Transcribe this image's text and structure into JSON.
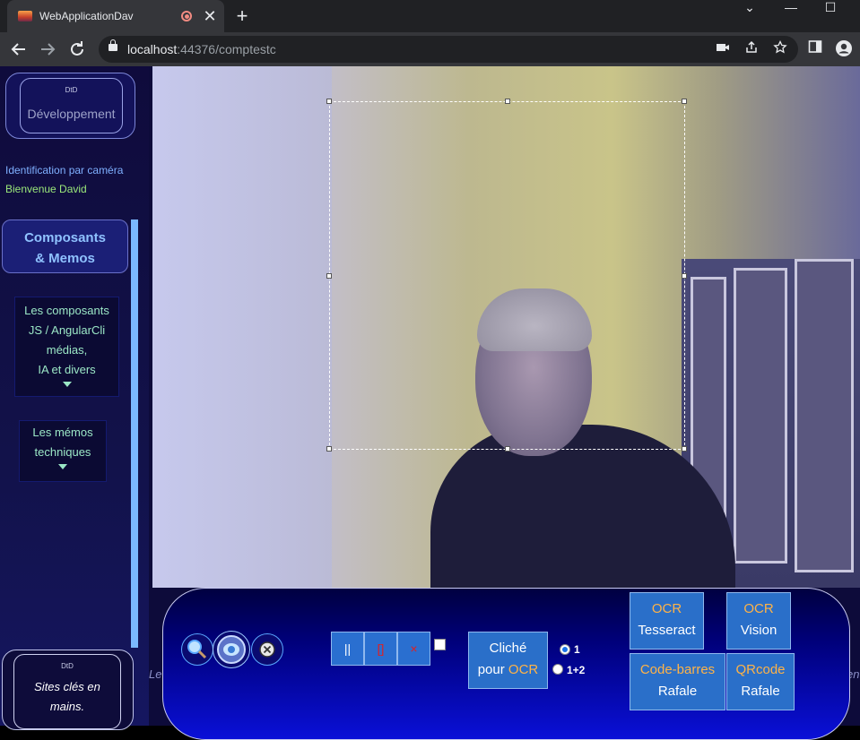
{
  "browser": {
    "tab_title": "WebApplicationDav",
    "new_tab": "+",
    "tab_close": "✕",
    "url_host": "localhost",
    "url_rest": ":44376/comptestc",
    "win_minimize": "—",
    "win_maximize": "☐",
    "win_dropdown": "⌄"
  },
  "sidebar": {
    "logo_mark": "DtD",
    "logo_text": "Développement",
    "identification": "Identification par caméra",
    "welcome": "Bienvenue David",
    "menu_head_line1": "Composants",
    "menu_head_line2": "& Memos",
    "components_lines": [
      "Les composants",
      "JS / AngularCli",
      "médias,",
      "IA et divers"
    ],
    "memos_lines": [
      "Les mémos",
      "techniques"
    ],
    "sites_mark": "DtD",
    "sites_line1": "Sites clés en",
    "sites_line2": "mains.",
    "partial_left": "Le",
    "partial_right": "en"
  },
  "panel": {
    "pause_label": "||",
    "stop_label": "[]",
    "close_label": "×",
    "snapshot_line1": "Cliché",
    "snapshot_line2_pre": "pour",
    "snapshot_line2_accent": "OCR",
    "radio_1": "1",
    "radio_12": "1+2",
    "ocr_tesseract_line1": "OCR",
    "ocr_tesseract_line2": "Tesseract",
    "ocr_vision_line1": "OCR",
    "ocr_vision_line2": "Vision",
    "barcode_line1": "Code-barres",
    "barcode_line2": "Rafale",
    "qrcode_line1": "QRcode",
    "qrcode_line2": "Rafale"
  }
}
